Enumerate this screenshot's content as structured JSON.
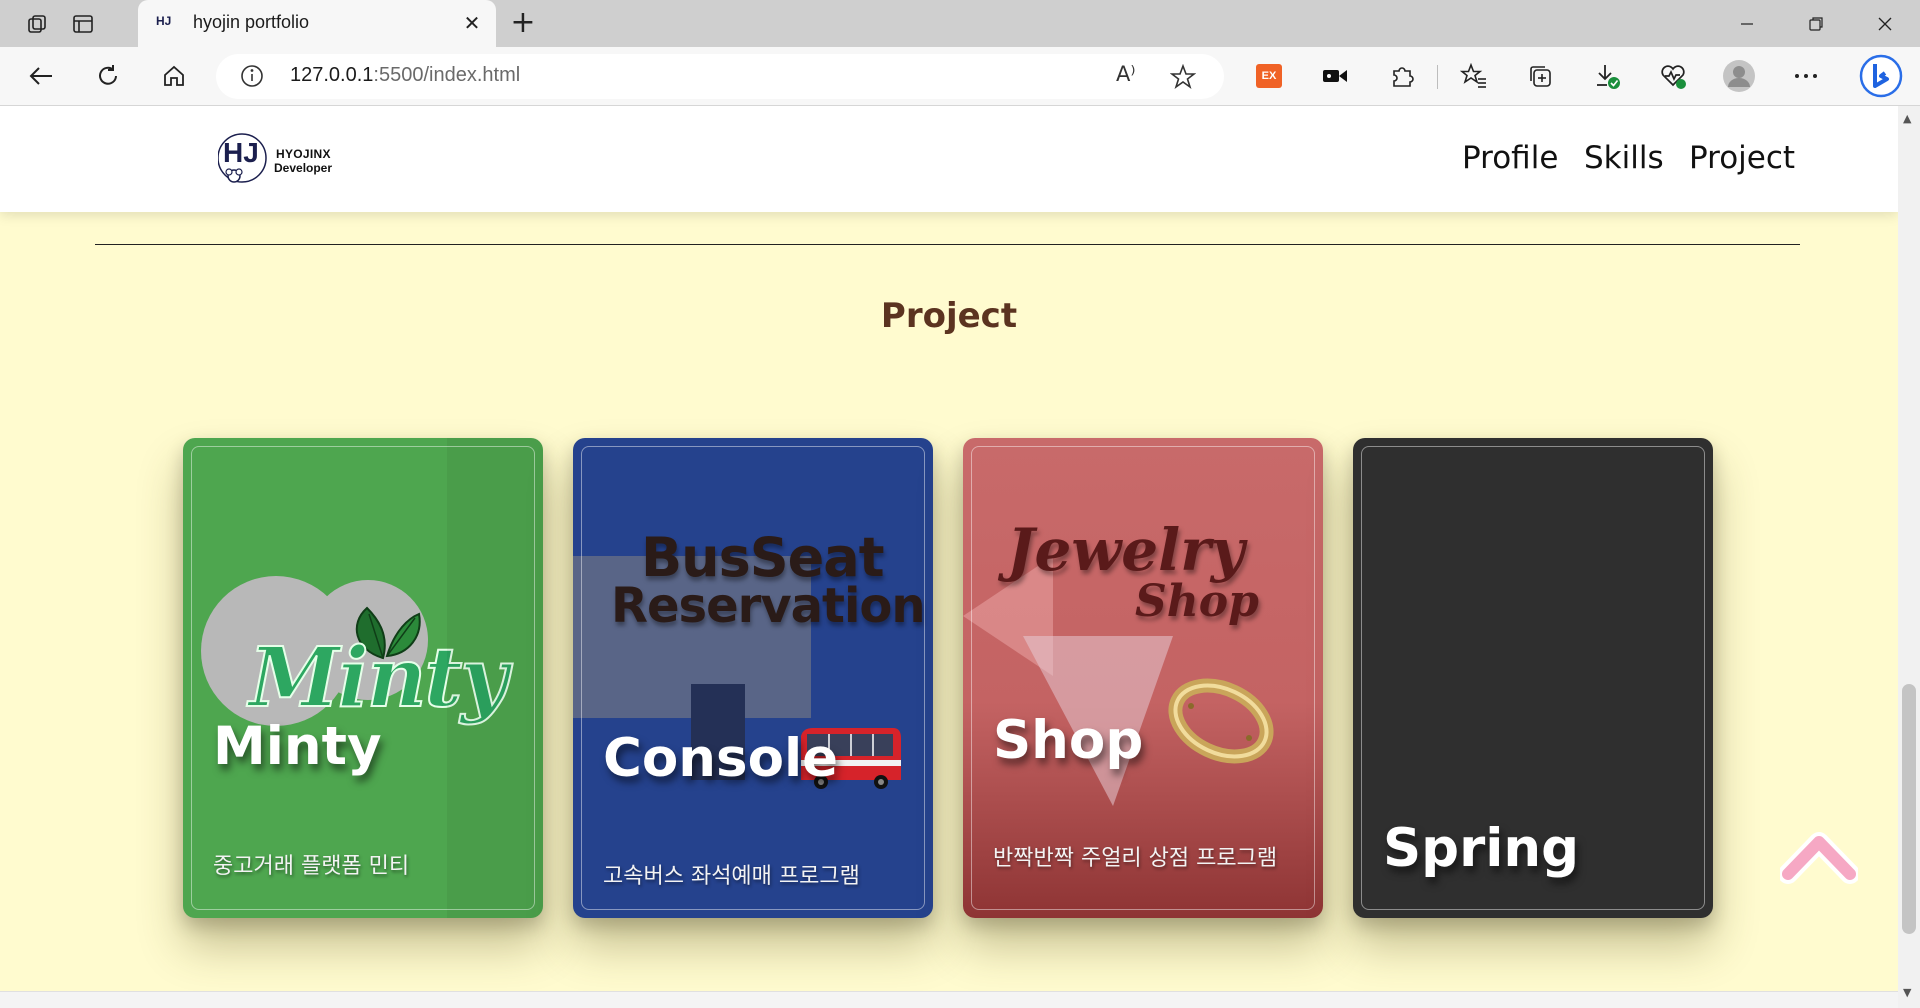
{
  "browser": {
    "tab_title": "hyojin portfolio",
    "tab_favicon_text": "HJ",
    "close_glyph": "✕",
    "newtab_glyph": "+",
    "url_host": "127.0.0.1",
    "url_rest": ":5500/index.html",
    "read_aloud_glyph": "A⁾",
    "ext_label": "EX"
  },
  "site": {
    "logo_name": "HYOJINX",
    "logo_sub": "Developer",
    "nav": [
      "Profile",
      "Skills",
      "Project"
    ],
    "section_title": "Project"
  },
  "cards": [
    {
      "name": "Minty",
      "desc": "중고거래 플랫폼 민티",
      "art_text": "Minty",
      "color": "#4ea64f"
    },
    {
      "name": "Console",
      "desc": "고속버스 좌석예매 프로그램",
      "art_text_1": "BusSeat",
      "art_text_2": "Reservation",
      "color": "#25428d"
    },
    {
      "name": "Shop",
      "desc": "반짝반짝 주얼리 상점 프로그램",
      "art_text_1": "Jewelry",
      "art_text_2": "Shop",
      "color": "#c46363"
    },
    {
      "name": "Spring",
      "desc": "",
      "color": "#2f2f2f"
    }
  ],
  "icons": [
    "workspaces-icon",
    "tab-actions-icon",
    "back-icon",
    "refresh-icon",
    "home-icon",
    "info-icon",
    "read-aloud-icon",
    "favorite-star-icon",
    "extension-ex-icon",
    "screen-record-icon",
    "extensions-puzzle-icon",
    "favorites-icon",
    "collections-icon",
    "downloads-icon",
    "performance-icon",
    "profile-avatar-icon",
    "more-icon",
    "bing-icon",
    "scroll-top-icon"
  ]
}
